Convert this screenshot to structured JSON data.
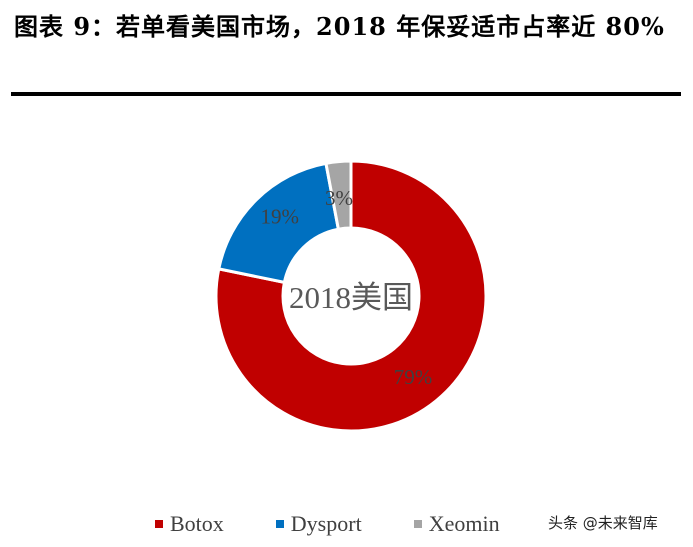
{
  "title": "图表 9：若单看美国市场，2018 年保妥适市占率近 80%",
  "watermark": "头条 @未来智库",
  "chart_data": {
    "type": "pie",
    "variant": "donut",
    "title": "图表 9：若单看美国市场，2018 年保妥适市占率近 80%",
    "center_label": "2018美国",
    "categories": [
      "Botox",
      "Dysport",
      "Xeomin"
    ],
    "values": [
      79,
      19,
      3
    ],
    "data_labels": [
      "79%",
      "19%",
      "3%"
    ],
    "colors": [
      "#C00000",
      "#0070C0",
      "#A5A5A5"
    ],
    "start": "12 o'clock",
    "direction": "clockwise",
    "legend_position": "bottom"
  }
}
